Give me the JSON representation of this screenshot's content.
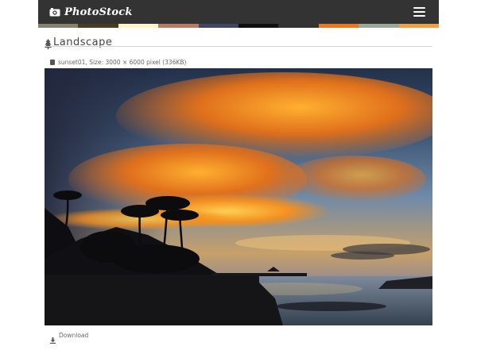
{
  "navbar": {
    "brand": "PhotoStock",
    "icons": {
      "logo": "camera-icon",
      "menu": "hamburger-menu-icon"
    }
  },
  "color_swatches": [
    "#8a8070",
    "#4a3c1e",
    "#fff4c8",
    "#b87a63",
    "#3e4864",
    "#101010",
    "#333333",
    "#e87a1c",
    "#9aa89a",
    "#f0a040"
  ],
  "category": {
    "title": "Landscape",
    "icon": "tree-icon"
  },
  "photo": {
    "info": "sunset01, Size: 3000 × 6000 pixel (336KB)",
    "info_icon": "file-icon"
  },
  "download": {
    "label": "Download",
    "icon": "download-icon"
  }
}
